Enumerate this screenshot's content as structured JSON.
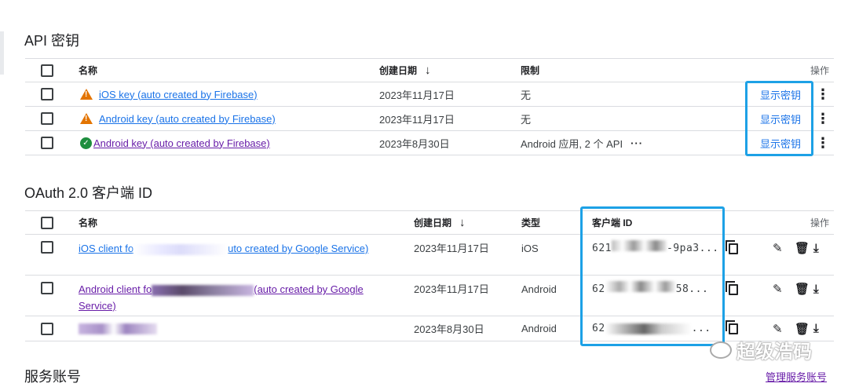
{
  "top_text": "",
  "api_keys": {
    "title": "API 密钥",
    "headers": {
      "name": "名称",
      "created": "创建日期",
      "sort_arrow": "↓",
      "restriction": "限制",
      "actions": "操作"
    },
    "rows": [
      {
        "status": "warning",
        "name": "iOS key (auto created by Firebase)",
        "created": "2023年11月17日",
        "restriction": "无",
        "action": "显示密钥"
      },
      {
        "status": "warning",
        "name": "Android key (auto created by Firebase)",
        "created": "2023年11月17日",
        "restriction": "无",
        "action": "显示密钥"
      },
      {
        "status": "ok",
        "name": "Android key (auto created by Firebase)",
        "created": "2023年8月30日",
        "restriction": "Android 应用, 2 个 API",
        "restriction_more": "···",
        "action": "显示密钥"
      }
    ]
  },
  "oauth": {
    "title": "OAuth 2.0 客户端 ID",
    "headers": {
      "name": "名称",
      "created": "创建日期",
      "sort_arrow": "↓",
      "type": "类型",
      "client_id": "客户端 ID",
      "actions": "操作"
    },
    "rows": [
      {
        "name_start": "iOS client fo",
        "name_end": "uto created by Google Service)",
        "created": "2023年11月17日",
        "type": "iOS",
        "client_id_start": "621",
        "client_id_end": "-9pa3..."
      },
      {
        "name_start": "Android client fo",
        "name_end": "(auto created by Google Service)",
        "created": "2023年11月17日",
        "type": "Android",
        "client_id_start": "62",
        "client_id_end": "58..."
      },
      {
        "name_start": "",
        "name_end": "",
        "created": "2023年8月30日",
        "type": "Android",
        "client_id_start": "62",
        "client_id_end": "..."
      }
    ]
  },
  "service_accounts": {
    "title": "服务账号",
    "manage_link": "管理服务账号"
  },
  "watermark": "超级浩码",
  "colors": {
    "link": "#1a73e8",
    "visited": "#681da8",
    "highlight": "#1da1e6",
    "warning": "#e37400",
    "ok": "#1e8e3e"
  }
}
